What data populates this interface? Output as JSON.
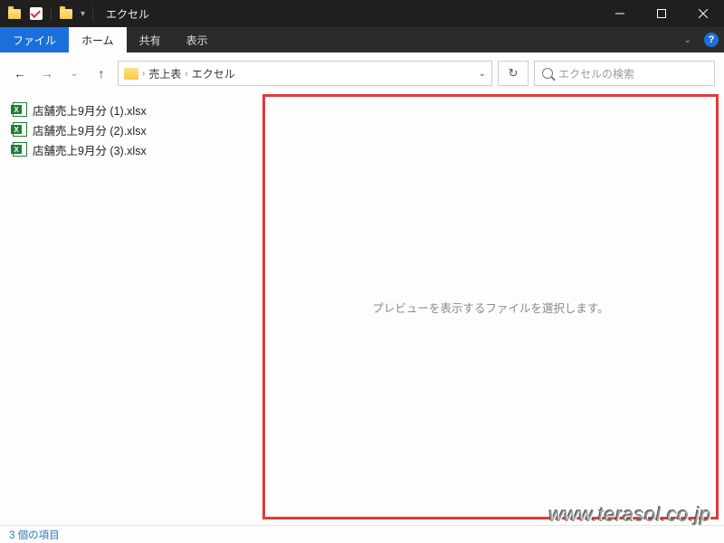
{
  "titlebar": {
    "title": "エクセル",
    "qat_icons": [
      "folder-icon",
      "checkbox-icon",
      "folder-icon"
    ]
  },
  "ribbon": {
    "file": "ファイル",
    "tabs": [
      "ホーム",
      "共有",
      "表示"
    ],
    "active_index": 0
  },
  "nav": {
    "breadcrumb": [
      "売上表",
      "エクセル"
    ],
    "refresh_glyph": "↻"
  },
  "search": {
    "placeholder": "エクセルの検索"
  },
  "files": [
    {
      "name": "店舗売上9月分 (1).xlsx"
    },
    {
      "name": "店舗売上9月分 (2).xlsx"
    },
    {
      "name": "店舗売上9月分 (3).xlsx"
    }
  ],
  "preview": {
    "empty_message": "プレビューを表示するファイルを選択します。"
  },
  "status": {
    "text": "3 個の項目"
  },
  "watermark": "www.terasol.co.jp"
}
